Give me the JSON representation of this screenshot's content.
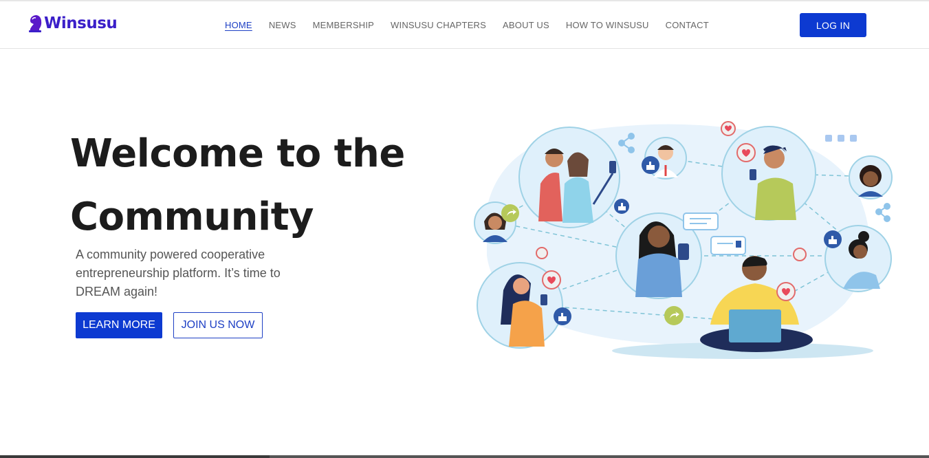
{
  "brand": {
    "name": "Winsusu",
    "logo_icon": "knight-chess-icon",
    "color": "#3b1fc9"
  },
  "nav": {
    "items": [
      {
        "label": "HOME",
        "active": true
      },
      {
        "label": "NEWS",
        "active": false
      },
      {
        "label": "MEMBERSHIP",
        "active": false
      },
      {
        "label": "WINSUSU CHAPTERS",
        "active": false
      },
      {
        "label": "ABOUT US",
        "active": false
      },
      {
        "label": "HOW TO WINSUSU",
        "active": false
      },
      {
        "label": "CONTACT",
        "active": false
      }
    ],
    "login_label": "LOG IN"
  },
  "hero": {
    "title_line1": "Welcome to the",
    "title_line2": "Community",
    "subtitle": "A community powered cooperative entrepreneurship platform. It’s time to DREAM again!",
    "primary_cta": "LEARN MORE",
    "secondary_cta": "JOIN US NOW"
  },
  "theme": {
    "accent": "#0d3ad1",
    "text_dark": "#1c1c1c",
    "text_muted": "#555555"
  },
  "illustration": {
    "icon": "social-network-community-illustration"
  }
}
